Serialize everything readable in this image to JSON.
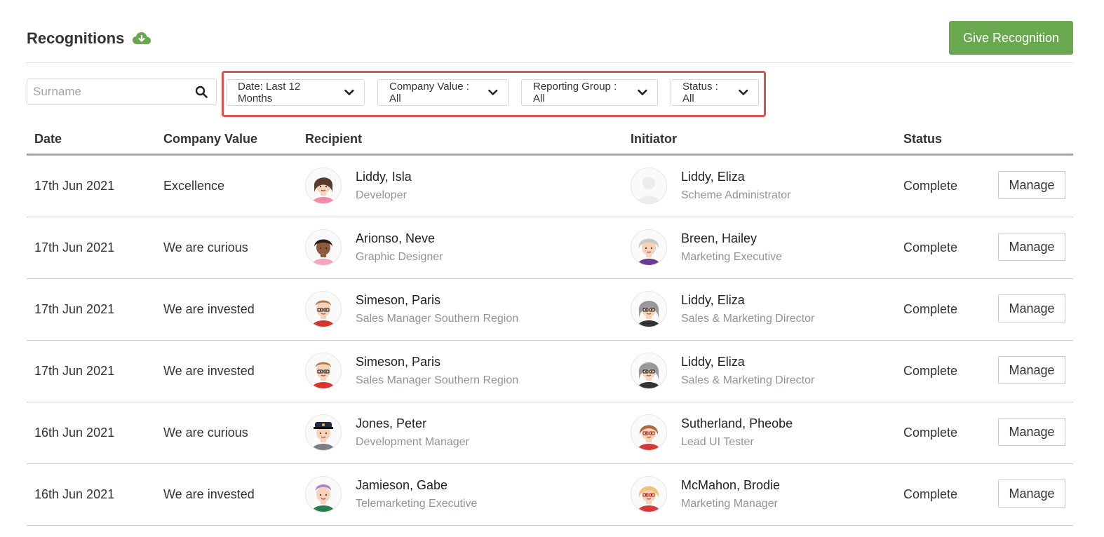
{
  "header": {
    "title": "Recognitions",
    "download_icon": "cloud-download-icon",
    "give_button": "Give Recognition",
    "accent_color": "#6aa84f"
  },
  "filters": {
    "search_placeholder": "Surname",
    "search_value": "",
    "date": "Date: Last 12 Months",
    "company_value": "Company Value : All",
    "reporting_group": "Reporting Group : All",
    "status": "Status : All",
    "highlight_color": "#d9534f"
  },
  "table": {
    "columns": [
      "Date",
      "Company Value",
      "Recipient",
      "Initiator",
      "Status"
    ],
    "manage_label": "Manage",
    "rows": [
      {
        "date": "17th Jun 2021",
        "value": "Excellence",
        "recipient_name": "Liddy, Isla",
        "recipient_role": "Developer",
        "recipient_avatar": "woman-brown-hair",
        "initiator_name": "Liddy, Eliza",
        "initiator_role": "Scheme Administrator",
        "initiator_avatar": "placeholder-silhouette",
        "status": "Complete"
      },
      {
        "date": "17th Jun 2021",
        "value": "We are curious",
        "recipient_name": "Arionso, Neve",
        "recipient_role": "Graphic Designer",
        "recipient_avatar": "woman-dark-skin",
        "initiator_name": "Breen, Hailey",
        "initiator_role": "Marketing Executive",
        "initiator_avatar": "woman-grey-hair",
        "status": "Complete"
      },
      {
        "date": "17th Jun 2021",
        "value": "We are invested",
        "recipient_name": "Simeson, Paris",
        "recipient_role": "Sales Manager Southern Region",
        "recipient_avatar": "man-glasses-red",
        "initiator_name": "Liddy, Eliza",
        "initiator_role": "Sales & Marketing Director",
        "initiator_avatar": "woman-grey-glasses",
        "status": "Complete"
      },
      {
        "date": "17th Jun 2021",
        "value": "We are invested",
        "recipient_name": "Simeson, Paris",
        "recipient_role": "Sales Manager Southern Region",
        "recipient_avatar": "man-glasses-red",
        "initiator_name": "Liddy, Eliza",
        "initiator_role": "Sales & Marketing Director",
        "initiator_avatar": "woman-grey-glasses",
        "status": "Complete"
      },
      {
        "date": "16th Jun 2021",
        "value": "We are curious",
        "recipient_name": "Jones, Peter",
        "recipient_role": "Development Manager",
        "recipient_avatar": "man-police-cap",
        "initiator_name": "Sutherland, Pheobe",
        "initiator_role": "Lead UI Tester",
        "initiator_avatar": "woman-ponytail-glasses",
        "status": "Complete"
      },
      {
        "date": "16th Jun 2021",
        "value": "We are invested",
        "recipient_name": "Jamieson, Gabe",
        "recipient_role": "Telemarketing Executive",
        "recipient_avatar": "man-purple-hair",
        "initiator_name": "McMahon, Brodie",
        "initiator_role": "Marketing Manager",
        "initiator_avatar": "woman-blonde-glasses",
        "status": "Complete"
      }
    ]
  }
}
